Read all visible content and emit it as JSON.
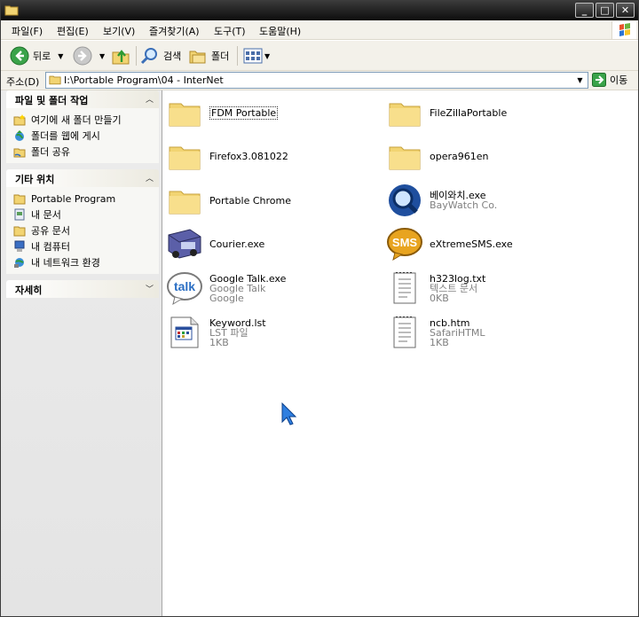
{
  "window": {
    "controls": {
      "minimize": "_",
      "maximize": "□",
      "close": "✕"
    }
  },
  "menubar": {
    "items": [
      "파일(F)",
      "편집(E)",
      "보기(V)",
      "즐겨찾기(A)",
      "도구(T)",
      "도움말(H)"
    ]
  },
  "toolbar": {
    "back_label": "뒤로",
    "search_label": "검색",
    "folders_label": "폴더"
  },
  "address": {
    "label": "주소(D)",
    "path": "I:\\Portable Program\\04 - InterNet",
    "go_label": "이동"
  },
  "left_pane": {
    "file_tasks": {
      "title": "파일 및 폴더 작업",
      "items": [
        {
          "label": "여기에 새 폴더 만들기",
          "icon": "new-folder-icon"
        },
        {
          "label": "폴더를 웹에 게시",
          "icon": "publish-web-icon"
        },
        {
          "label": "폴더 공유",
          "icon": "share-folder-icon"
        }
      ]
    },
    "other_places": {
      "title": "기타 위치",
      "items": [
        {
          "label": "Portable Program",
          "icon": "folder-icon"
        },
        {
          "label": "내 문서",
          "icon": "my-documents-icon"
        },
        {
          "label": "공유 문서",
          "icon": "shared-documents-icon"
        },
        {
          "label": "내 컴퓨터",
          "icon": "my-computer-icon"
        },
        {
          "label": "내 네트워크 환경",
          "icon": "network-icon"
        }
      ]
    },
    "details": {
      "title": "자세히"
    }
  },
  "files": [
    {
      "name": "FDM Portable",
      "sub1": "",
      "sub2": "",
      "icon": "folder-icon",
      "selected": true
    },
    {
      "name": "FileZillaPortable",
      "sub1": "",
      "sub2": "",
      "icon": "folder-icon"
    },
    {
      "name": "Firefox3.081022",
      "sub1": "",
      "sub2": "",
      "icon": "folder-icon"
    },
    {
      "name": "opera961en",
      "sub1": "",
      "sub2": "",
      "icon": "folder-icon"
    },
    {
      "name": "Portable Chrome",
      "sub1": "",
      "sub2": "",
      "icon": "folder-icon"
    },
    {
      "name": "베이와치.exe",
      "sub1": "BayWatch Co.",
      "sub2": "",
      "icon": "baywatch-icon"
    },
    {
      "name": "Courier.exe",
      "sub1": "",
      "sub2": "",
      "icon": "courier-truck-icon"
    },
    {
      "name": "eXtremeSMS.exe",
      "sub1": "",
      "sub2": "",
      "icon": "sms-icon"
    },
    {
      "name": "Google Talk.exe",
      "sub1": "Google Talk",
      "sub2": "Google",
      "icon": "google-talk-icon"
    },
    {
      "name": "h323log.txt",
      "sub1": "텍스트 문서",
      "sub2": "0KB",
      "icon": "text-document-icon"
    },
    {
      "name": "Keyword.lst",
      "sub1": "LST 파일",
      "sub2": "1KB",
      "icon": "lst-file-icon"
    },
    {
      "name": "ncb.htm",
      "sub1": "SafariHTML",
      "sub2": "1KB",
      "icon": "html-document-icon"
    }
  ]
}
